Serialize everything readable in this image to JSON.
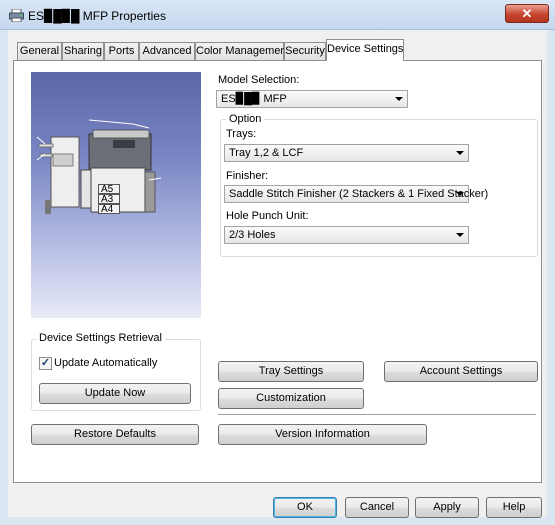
{
  "window": {
    "title": "ES▉█▉█ MFP Properties",
    "close_glyph": "✕",
    "icon": "printer-icon"
  },
  "tabs": [
    {
      "label": "General"
    },
    {
      "label": "Sharing"
    },
    {
      "label": "Ports"
    },
    {
      "label": "Advanced"
    },
    {
      "label": "Color Management"
    },
    {
      "label": "Security"
    },
    {
      "label": "Device Settings",
      "active": true
    }
  ],
  "preview": {
    "paper_sizes": [
      "A5",
      "A3",
      "A4"
    ]
  },
  "model": {
    "label": "Model Selection:",
    "value": "ES▉█▉ MFP"
  },
  "option": {
    "legend": "Option",
    "trays": {
      "label": "Trays:",
      "value": "Tray 1,2 & LCF"
    },
    "finisher": {
      "label": "Finisher:",
      "value": "Saddle Stitch Finisher (2 Stackers & 1 Fixed Stacker)"
    },
    "hole_punch": {
      "label": "Hole Punch Unit:",
      "value": "2/3 Holes"
    }
  },
  "retrieval": {
    "legend": "Device Settings Retrieval",
    "update_auto_label": "Update Automatically",
    "update_auto_checked": true,
    "check_glyph": "✓",
    "update_now_label": "Update Now"
  },
  "buttons": {
    "restore_defaults": "Restore Defaults",
    "tray_settings": "Tray Settings",
    "account_settings": "Account Settings",
    "customization": "Customization",
    "version_information": "Version Information"
  },
  "dialog": {
    "ok": "OK",
    "cancel": "Cancel",
    "apply": "Apply",
    "help": "Help"
  },
  "colors": {
    "titlebar": "#c5d7ee",
    "close": "#c7452f",
    "preview_top": "#5a67a8",
    "preview_bottom": "#e9ebf8",
    "default_button_border": "#3c7fb1"
  }
}
